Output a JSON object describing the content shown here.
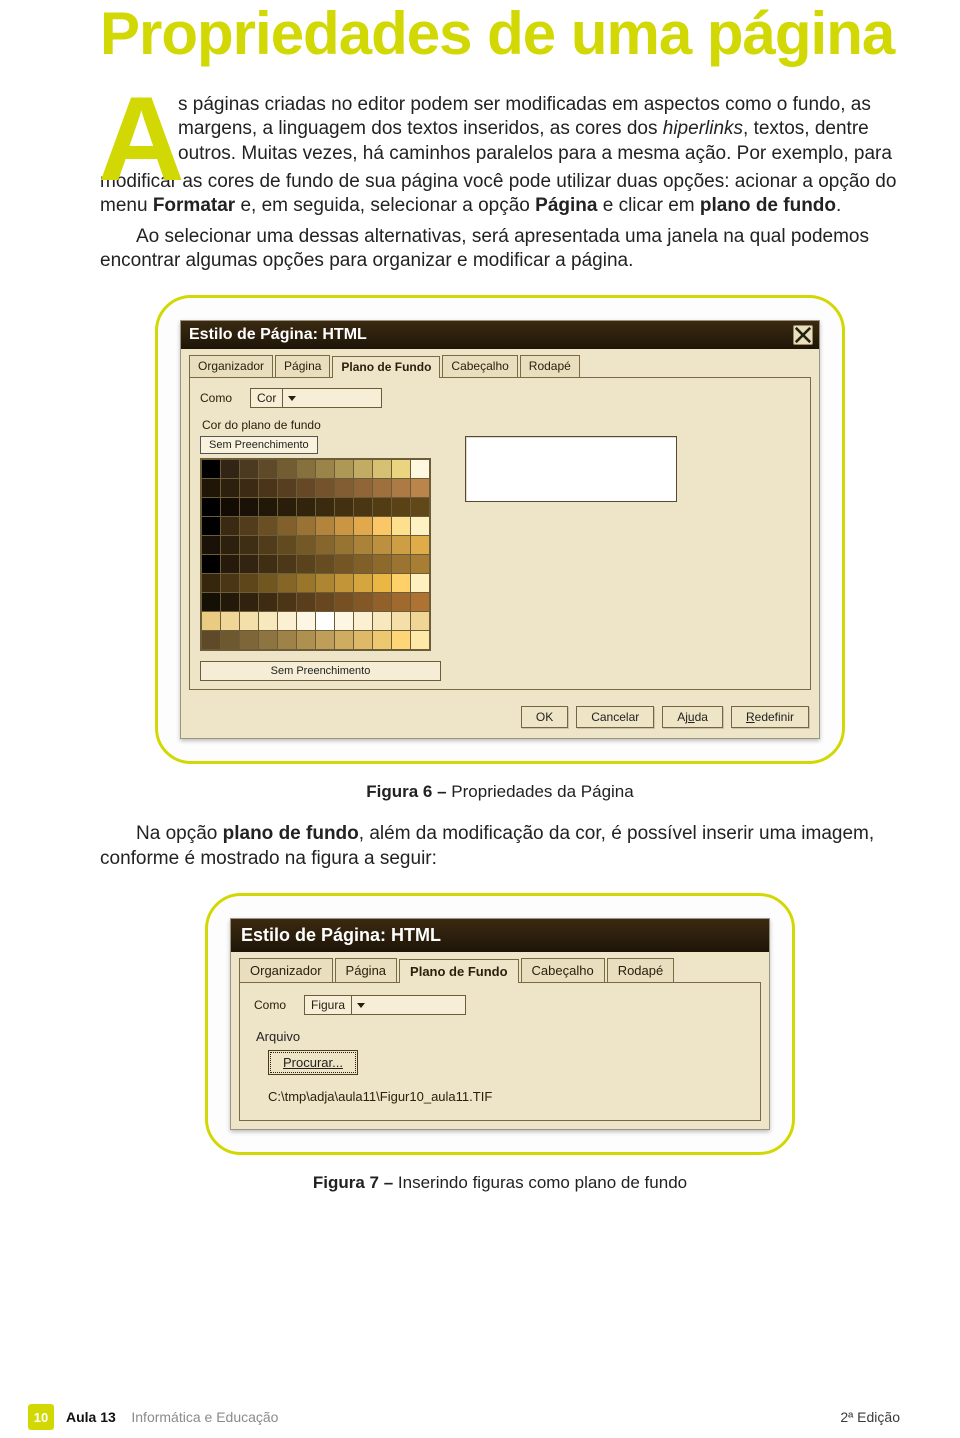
{
  "title": "Propriedades de uma página",
  "dropcap": "A",
  "paragraph1_lead": "s páginas criadas no editor podem ser modificadas em aspectos como o fundo, as margens, a linguagem dos textos inseridos, as cores dos ",
  "paragraph1_italic": "hiperlinks",
  "paragraph1_tail": ", textos, dentre outros. Muitas vezes, há caminhos paralelos para a mesma ação. Por exemplo, para",
  "paragraph1_line2_a": "modificar as cores de fundo de sua página você pode utilizar duas opções: acionar a opção do menu ",
  "paragraph1_formatar": "Formatar",
  "paragraph1_line2_b": " e, em seguida, selecionar a opção ",
  "paragraph1_pagina": "Página",
  "paragraph1_line2_c": " e clicar em ",
  "paragraph1_plano": "plano de fundo",
  "paragraph1_line2_d": ".",
  "paragraph2": "Ao selecionar uma dessas alternativas, será apresentada uma janela na qual podemos encontrar algumas opções para organizar e modificar a página.",
  "fig6": {
    "dialog_title": "Estilo de Página: HTML",
    "tabs": [
      "Organizador",
      "Página",
      "Plano de Fundo",
      "Cabeçalho",
      "Rodapé"
    ],
    "active_tab": 2,
    "como_label": "Como",
    "como_value": "Cor",
    "fieldset_label": "Cor do plano de fundo",
    "selected_swatch_label": "Sem Preenchimento",
    "no_fill_bar": "Sem Preenchimento",
    "buttons": {
      "ok": "OK",
      "cancel": "Cancelar",
      "help": "Ajuda",
      "redefine": "Redefinir",
      "help_ul": "u",
      "redef_ul": "R"
    },
    "palette_rows": [
      [
        "#000000",
        "#322516",
        "#4a3a20",
        "#5e4a28",
        "#725c32",
        "#86703e",
        "#9a844a",
        "#ae9856",
        "#c2ac64",
        "#d6c072",
        "#ead480",
        "#fff8e0"
      ],
      [
        "#201608",
        "#2e200e",
        "#3c2a14",
        "#4a341a",
        "#583e20",
        "#664826",
        "#74522c",
        "#825c32",
        "#906638",
        "#9e703e",
        "#ac7a44",
        "#ba844a"
      ],
      [
        "#000000",
        "#120c04",
        "#1a1206",
        "#221808",
        "#2a1e0a",
        "#32240c",
        "#3a2a0e",
        "#423010",
        "#4a3612",
        "#523c14",
        "#5a4216",
        "#624818"
      ],
      [
        "#000000",
        "#3a2a14",
        "#523c1c",
        "#6a4e24",
        "#82602c",
        "#9a7234",
        "#b2843c",
        "#ca9644",
        "#e2a84c",
        "#fbc766",
        "#fde08e",
        "#fff2c2"
      ],
      [
        "#1a1208",
        "#2c200e",
        "#3e2e14",
        "#503c1a",
        "#624a20",
        "#745826",
        "#86662c",
        "#987432",
        "#aa8238",
        "#bc903e",
        "#ce9e44",
        "#e0ac4a"
      ],
      [
        "#000000",
        "#251a0c",
        "#322410",
        "#3f2e14",
        "#4c3818",
        "#59421c",
        "#664c20",
        "#735624",
        "#806028",
        "#8d6a2c",
        "#9a7430",
        "#a77e34"
      ],
      [
        "#36260e",
        "#4a3614",
        "#5e461a",
        "#725620",
        "#866626",
        "#9a762c",
        "#ae8632",
        "#c29638",
        "#d6a63e",
        "#eab644",
        "#fed06a",
        "#fff0c0"
      ],
      [
        "#141006",
        "#22190a",
        "#30220e",
        "#3e2b12",
        "#4c3416",
        "#5a3d1a",
        "#68461e",
        "#764f22",
        "#845826",
        "#92612a",
        "#a06a2e",
        "#ae7332"
      ],
      [
        "#eacb82",
        "#f0d696",
        "#f4dfaa",
        "#f8e8be",
        "#fbf0d2",
        "#fdf6e2",
        "#ffffff",
        "#fdf6e2",
        "#fbf0d2",
        "#f8e8be",
        "#f4dfaa",
        "#f0d696"
      ],
      [
        "#5e4a28",
        "#6e5830",
        "#7e6638",
        "#8e7440",
        "#9e8248",
        "#ae9050",
        "#be9e58",
        "#ceac60",
        "#deba68",
        "#eec870",
        "#fed678",
        "#ffe9a8"
      ]
    ]
  },
  "caption6_bold": "Figura 6 –",
  "caption6_rest": " Propriedades da Página",
  "after_fig6_a": "Na opção ",
  "after_fig6_bold": "plano de fundo",
  "after_fig6_b": ", além da modificação da cor, é possível inserir uma imagem, conforme é mostrado na figura a seguir:",
  "fig7": {
    "dialog_title": "Estilo de Página: HTML",
    "tabs": [
      "Organizador",
      "Página",
      "Plano de Fundo",
      "Cabeçalho",
      "Rodapé"
    ],
    "active_tab": 2,
    "como_label": "Como",
    "como_value": "Figura",
    "arquivo_label": "Arquivo",
    "procurar_label": "Procurar...",
    "filepath": "C:\\tmp\\adja\\aula11\\Figur10_aula11.TIF"
  },
  "caption7_bold": "Figura 7 –",
  "caption7_rest": " Inserindo figuras como plano de fundo",
  "footer": {
    "page_number": "10",
    "aula_bold": "Aula 13",
    "aula_light": "Informática e Educação",
    "edition": "2ª Edição"
  }
}
